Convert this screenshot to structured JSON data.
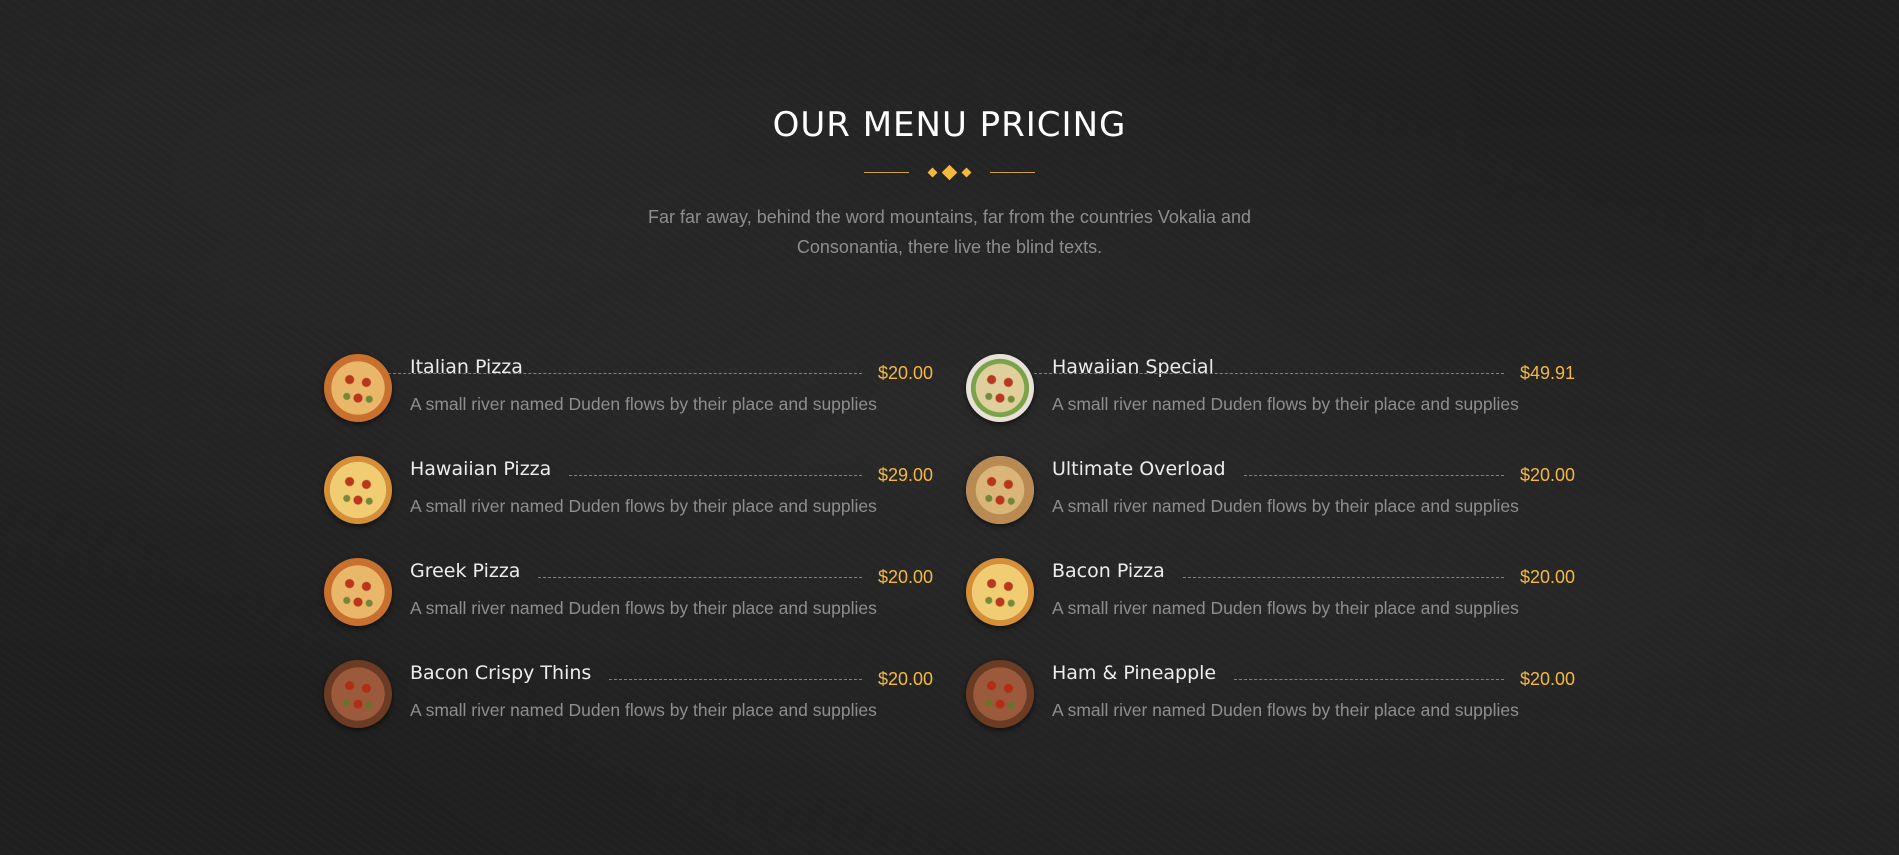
{
  "section": {
    "title": "OUR MENU PRICING",
    "subtitle": "Far far away, behind the word mountains, far from the countries Vokalia and Consonantia, there live the blind texts."
  },
  "colors": {
    "background": "#1f1f1f",
    "accent": "#f4b942",
    "text_muted": "#8e8e8e",
    "heading": "#ffffff"
  },
  "menu": {
    "left": [
      {
        "name": "Italian Pizza",
        "price": "$20.00",
        "description": "A small river named Duden flows by their place and supplies",
        "image_icon": "pizza-slices-icon"
      },
      {
        "name": "Hawaiian Pizza",
        "price": "$29.00",
        "description": "A small river named Duden flows by their place and supplies",
        "image_icon": "pizza-icon"
      },
      {
        "name": "Greek Pizza",
        "price": "$20.00",
        "description": "A small river named Duden flows by their place and supplies",
        "image_icon": "pizza-icon"
      },
      {
        "name": "Bacon Crispy Thins",
        "price": "$20.00",
        "description": "A small river named Duden flows by their place and supplies",
        "image_icon": "pizza-icon"
      }
    ],
    "right": [
      {
        "name": "Hawaiian Special",
        "price": "$49.91",
        "description": "A small river named Duden flows by their place and supplies",
        "image_icon": "pizza-plate-icon"
      },
      {
        "name": "Ultimate Overload",
        "price": "$20.00",
        "description": "A small river named Duden flows by their place and supplies",
        "image_icon": "pizza-plate-icon"
      },
      {
        "name": "Bacon Pizza",
        "price": "$20.00",
        "description": "A small river named Duden flows by their place and supplies",
        "image_icon": "pizza-icon"
      },
      {
        "name": "Ham & Pineapple",
        "price": "$20.00",
        "description": "A small river named Duden flows by their place and supplies",
        "image_icon": "pizza-plate-icon"
      }
    ]
  }
}
